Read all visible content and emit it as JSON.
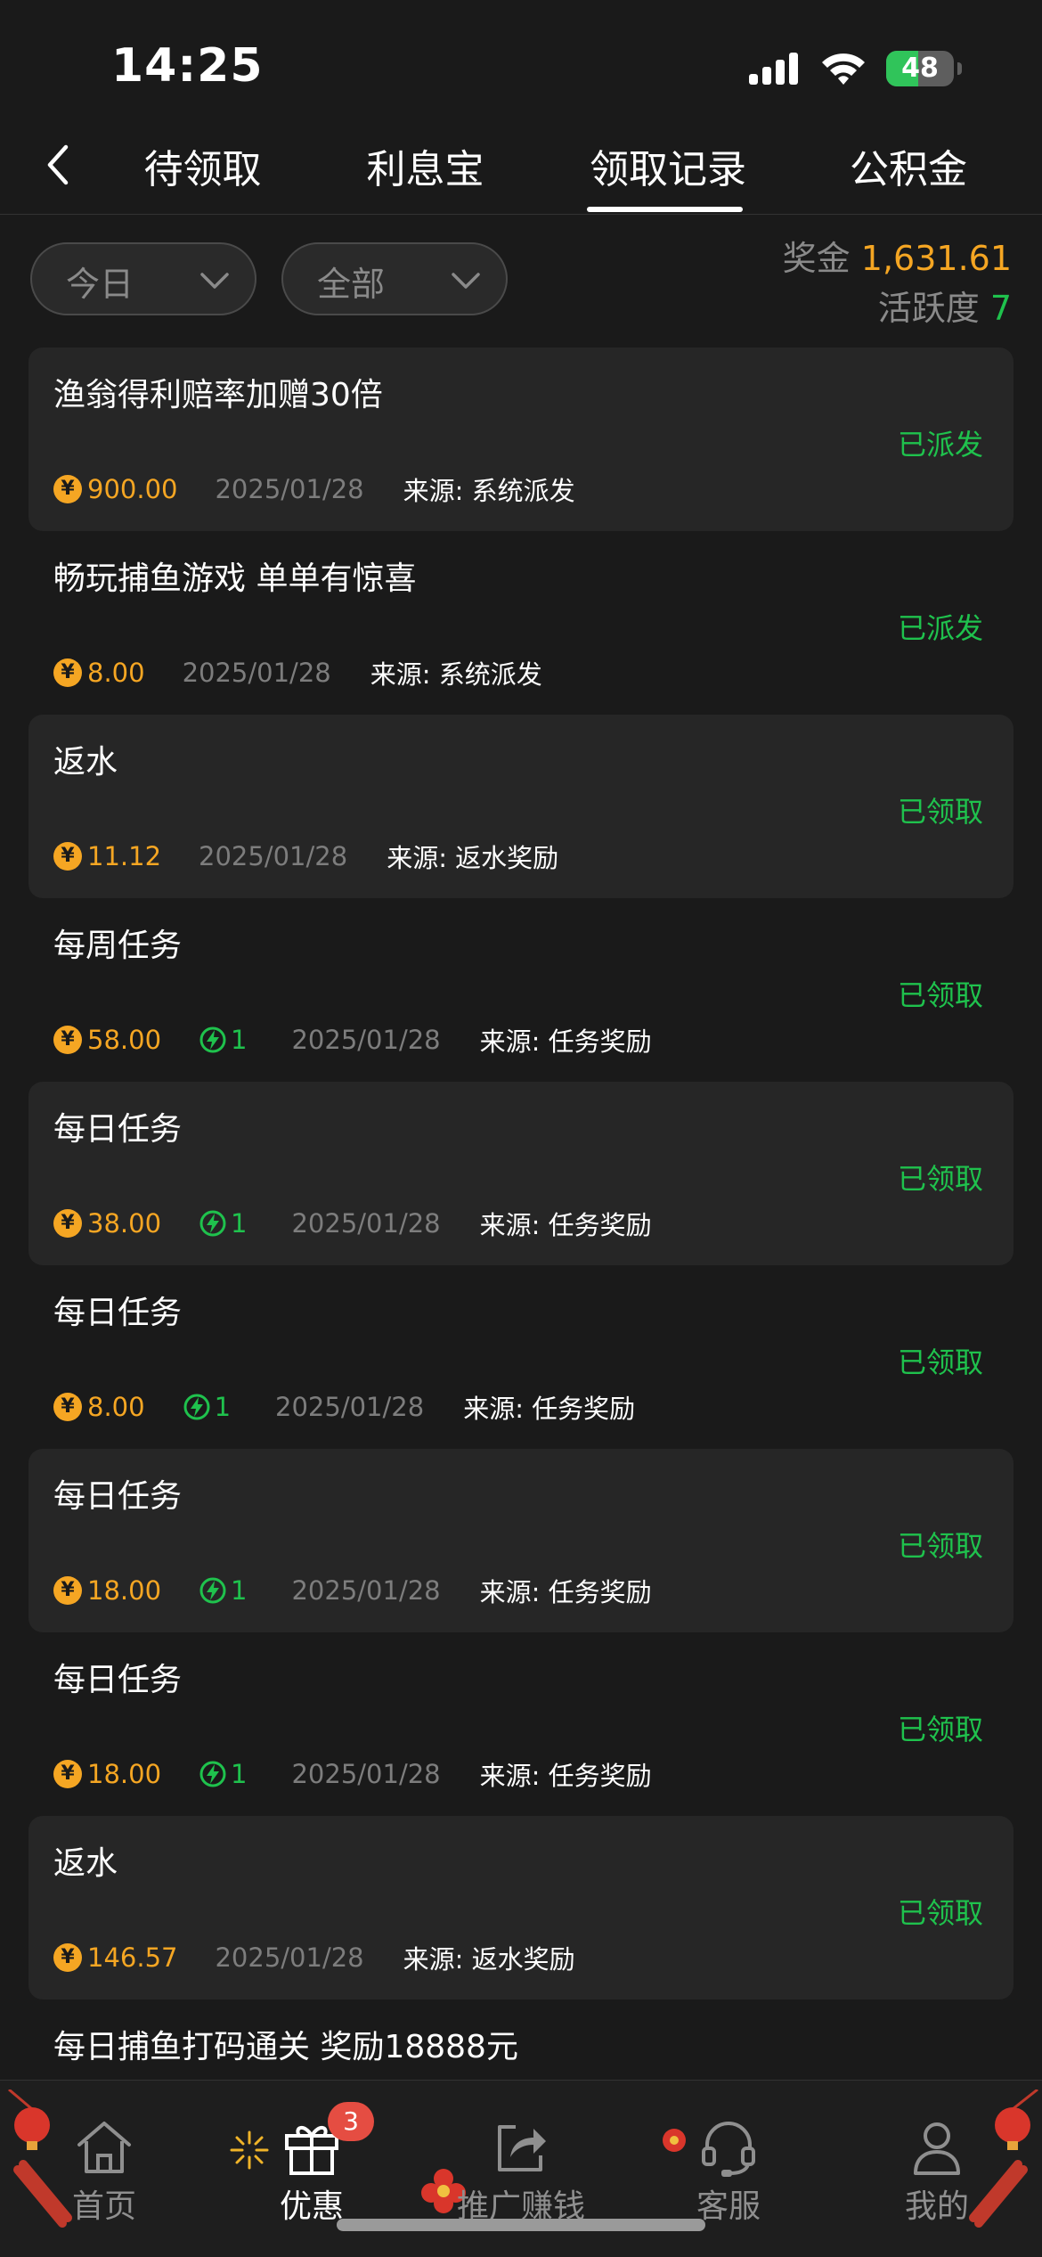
{
  "status_bar": {
    "time": "14:25",
    "battery": "48",
    "battery_level": 0.48
  },
  "nav": {
    "tabs": [
      {
        "label": "待领取"
      },
      {
        "label": "利息宝"
      },
      {
        "label": "领取记录"
      },
      {
        "label": "公积金"
      }
    ],
    "active_tab": "领取记录"
  },
  "filters": {
    "date_value": "今日",
    "type_value": "全部"
  },
  "summary": {
    "bonus_label": "奖金",
    "bonus_value": "1,631.61",
    "activity_label": "活跃度",
    "activity_value": "7"
  },
  "records": [
    {
      "title": "渔翁得利赔率加赠30倍",
      "status": "已派发",
      "amount": "900.00",
      "activity": "",
      "date": "2025/01/28",
      "source": "来源: 系统派发"
    },
    {
      "title": "畅玩捕鱼游戏 单单有惊喜",
      "status": "已派发",
      "amount": "8.00",
      "activity": "",
      "date": "2025/01/28",
      "source": "来源: 系统派发"
    },
    {
      "title": "返水",
      "status": "已领取",
      "amount": "11.12",
      "activity": "",
      "date": "2025/01/28",
      "source": "来源: 返水奖励"
    },
    {
      "title": "每周任务",
      "status": "已领取",
      "amount": "58.00",
      "activity": "1",
      "date": "2025/01/28",
      "source": "来源: 任务奖励"
    },
    {
      "title": "每日任务",
      "status": "已领取",
      "amount": "38.00",
      "activity": "1",
      "date": "2025/01/28",
      "source": "来源: 任务奖励"
    },
    {
      "title": "每日任务",
      "status": "已领取",
      "amount": "8.00",
      "activity": "1",
      "date": "2025/01/28",
      "source": "来源: 任务奖励"
    },
    {
      "title": "每日任务",
      "status": "已领取",
      "amount": "18.00",
      "activity": "1",
      "date": "2025/01/28",
      "source": "来源: 任务奖励"
    },
    {
      "title": "每日任务",
      "status": "已领取",
      "amount": "18.00",
      "activity": "1",
      "date": "2025/01/28",
      "source": "来源: 任务奖励"
    },
    {
      "title": "返水",
      "status": "已领取",
      "amount": "146.57",
      "activity": "",
      "date": "2025/01/28",
      "source": "来源: 返水奖励"
    }
  ],
  "partial_record": {
    "title": "每日捕鱼打码通关 奖励18888元"
  },
  "tabbar": {
    "items": [
      {
        "label": "首页",
        "icon": "home-icon"
      },
      {
        "label": "优惠",
        "icon": "gift-icon",
        "badge": "3"
      },
      {
        "label": "推广赚钱",
        "icon": "share-icon"
      },
      {
        "label": "客服",
        "icon": "headset-icon"
      },
      {
        "label": "我的",
        "icon": "user-icon"
      }
    ],
    "active": "优惠"
  },
  "colors": {
    "background": "#1a1a1a",
    "card": "#262626",
    "accent_orange": "#f5a623",
    "accent_green": "#1fc24d",
    "badge_red": "#e54d42"
  }
}
